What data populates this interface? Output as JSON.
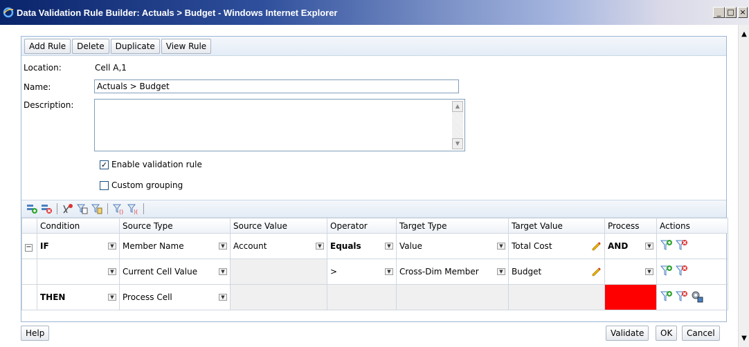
{
  "window": {
    "title": "Data Validation Rule Builder: Actuals > Budget - Windows Internet Explorer",
    "minimize": "_",
    "maximize": "□",
    "close": "×"
  },
  "toolbar": {
    "add_rule": "Add Rule",
    "delete": "Delete",
    "duplicate": "Duplicate",
    "view_rule": "View Rule"
  },
  "form": {
    "location_label": "Location:",
    "location_value": "Cell A,1",
    "name_label": "Name:",
    "name_value": "Actuals > Budget",
    "description_label": "Description:",
    "description_value": "",
    "enable_label": "Enable validation rule",
    "enable_checked": true,
    "custom_grouping_label": "Custom grouping",
    "custom_grouping_checked": false
  },
  "grid": {
    "headers": [
      "",
      "Condition",
      "Source Type",
      "Source Value",
      "Operator",
      "Target Type",
      "Target Value",
      "Process",
      "Actions"
    ],
    "rows": [
      {
        "expand": "−",
        "condition": "IF",
        "source_type": "Member Name",
        "source_value": "Account",
        "operator": "Equals",
        "target_type": "Value",
        "target_value": "Total Cost",
        "process": "AND"
      },
      {
        "expand": "",
        "condition": "",
        "source_type": "Current Cell Value",
        "source_value": "",
        "operator": ">",
        "target_type": "Cross-Dim Member",
        "target_value": "Budget",
        "process": ""
      },
      {
        "expand": "",
        "condition": "THEN",
        "source_type": "Process Cell",
        "source_value": "",
        "operator": "",
        "target_type": "",
        "target_value": "",
        "process": ""
      }
    ],
    "process_color": "#ff0000"
  },
  "footer": {
    "help": "Help",
    "validate": "Validate",
    "ok": "OK",
    "cancel": "Cancel"
  }
}
